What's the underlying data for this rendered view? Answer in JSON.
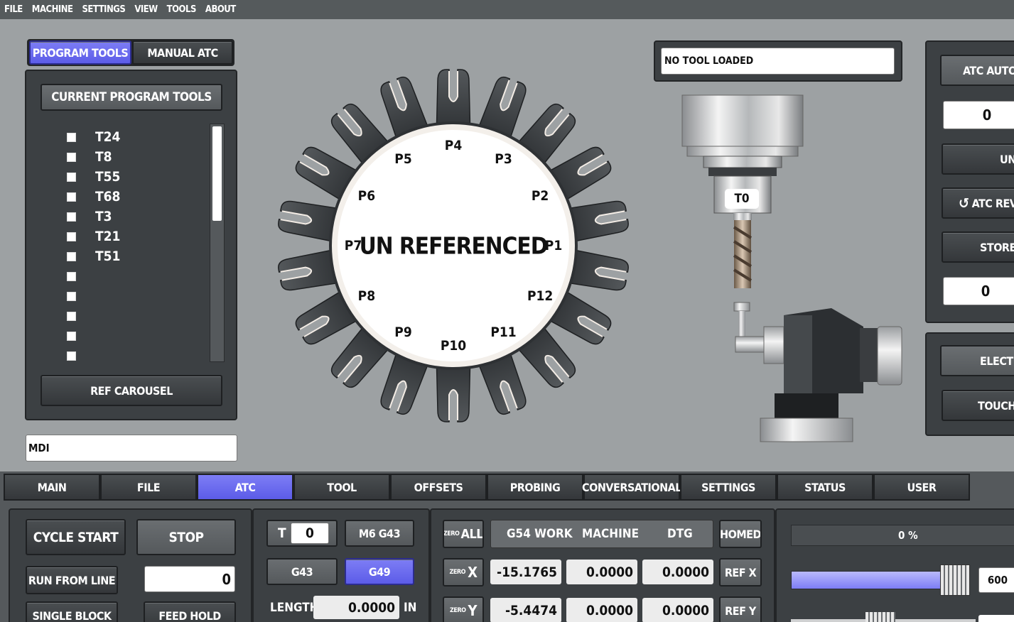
{
  "menu": [
    "FILE",
    "MACHINE",
    "SETTINGS",
    "VIEW",
    "TOOLS",
    "ABOUT"
  ],
  "tool_tabs": {
    "program_tools": "PROGRAM TOOLS",
    "manual_atc": "MANUAL ATC"
  },
  "tool_list": {
    "header": "CURRENT PROGRAM TOOLS",
    "items": [
      "T24",
      "T8",
      "T55",
      "T68",
      "T3",
      "T21",
      "T51",
      "",
      "",
      "",
      "",
      ""
    ],
    "ref_button": "REF CAROUSEL"
  },
  "mdi": {
    "label": "MDI"
  },
  "carousel": {
    "status": "UN REFERENCED",
    "pockets": [
      "P1",
      "P2",
      "P3",
      "P4",
      "P5",
      "P6",
      "P7",
      "P8",
      "P9",
      "P10",
      "P11",
      "P12"
    ]
  },
  "spindle": {
    "status": "NO TOOL LOADED",
    "tool_label": "T0"
  },
  "atc_panel": {
    "auto_button": "ATC AUTOM",
    "value1": "0",
    "unload_button": "UNL",
    "rev_button": "ATC REV",
    "store_button": "STORE T",
    "value2": "0",
    "elec_button": "ELECTR",
    "touch_button": "TOUCH O"
  },
  "main_tabs": [
    "MAIN",
    "FILE",
    "ATC",
    "TOOL",
    "OFFSETS",
    "PROBING",
    "CONVERSATIONAL",
    "SETTINGS",
    "STATUS",
    "USER"
  ],
  "controls": {
    "cycle_start": "CYCLE START",
    "stop": "STOP",
    "run_from_line": "RUN FROM LINE",
    "line_value": "0",
    "single_block": "SINGLE BLOCK",
    "feed_hold": "FEED HOLD"
  },
  "tool_offset": {
    "t_label": "T",
    "t_value": "0",
    "m6_button": "M6 G43",
    "g43_button": "G43",
    "g49_button": "G49",
    "length_label": "LENGTH",
    "length_value": "0.0000",
    "unit": "IN"
  },
  "dro": {
    "zero_all_small": "ZERO",
    "zero_all_big": "ALL",
    "headers": [
      "G54 WORK",
      "MACHINE",
      "DTG"
    ],
    "homed": "HOMED",
    "axes": [
      {
        "zero_small": "ZERO",
        "axis": "X",
        "work": "-15.1765",
        "machine": "0.0000",
        "dtg": "0.0000",
        "ref": "REF X"
      },
      {
        "zero_small": "ZERO",
        "axis": "Y",
        "work": "-5.4474",
        "machine": "0.0000",
        "dtg": "0.0000",
        "ref": "REF Y"
      }
    ]
  },
  "overrides": {
    "percent_label": "0 %",
    "feed_value": "600",
    "feed_fraction": 0.84
  }
}
